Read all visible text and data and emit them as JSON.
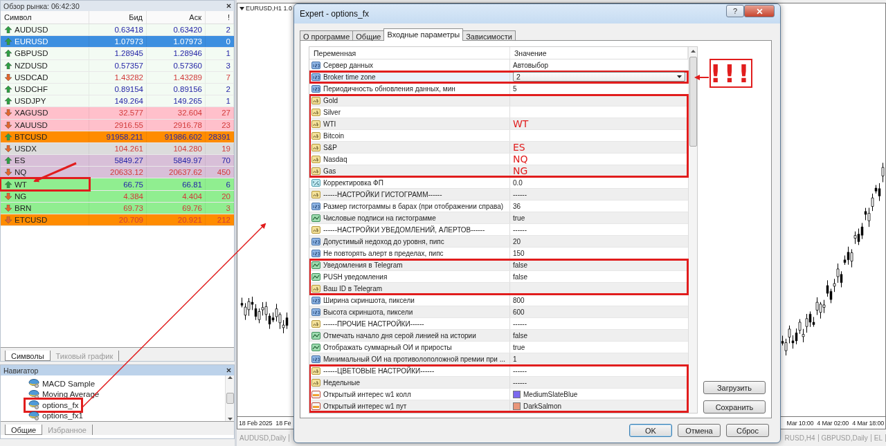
{
  "market_watch": {
    "title": "Обзор рынка: 06:42:30",
    "columns": [
      "Символ",
      "Бид",
      "Аск",
      "!"
    ],
    "rows": [
      {
        "symbol": "AUDUSD",
        "bid": "0.63418",
        "ask": "0.63420",
        "spread": "2",
        "up": true,
        "color": "#f3fbf3",
        "selected": false,
        "outlined": false
      },
      {
        "symbol": "EURUSD",
        "bid": "1.07973",
        "ask": "1.07973",
        "spread": "0",
        "up": true,
        "selected": true,
        "outlined": false
      },
      {
        "symbol": "GBPUSD",
        "bid": "1.28945",
        "ask": "1.28946",
        "spread": "1",
        "up": true,
        "color": "#f3fbf3",
        "selected": false,
        "outlined": false
      },
      {
        "symbol": "NZDUSD",
        "bid": "0.57357",
        "ask": "0.57360",
        "spread": "3",
        "up": true,
        "color": "#f3fbf3",
        "selected": false,
        "outlined": false
      },
      {
        "symbol": "USDCAD",
        "bid": "1.43282",
        "ask": "1.43289",
        "spread": "7",
        "up": false,
        "color": "#f3fbf3",
        "selected": false,
        "outlined": false
      },
      {
        "symbol": "USDCHF",
        "bid": "0.89154",
        "ask": "0.89156",
        "spread": "2",
        "up": true,
        "color": "#f3fbf3",
        "selected": false,
        "outlined": false
      },
      {
        "symbol": "USDJPY",
        "bid": "149.264",
        "ask": "149.265",
        "spread": "1",
        "up": true,
        "color": "#f3fbf3",
        "selected": false,
        "outlined": false
      },
      {
        "symbol": "XAGUSD",
        "bid": "32.577",
        "ask": "32.604",
        "spread": "27",
        "up": false,
        "color": "#ffc0cb",
        "selected": false,
        "outlined": false
      },
      {
        "symbol": "XAUUSD",
        "bid": "2916.55",
        "ask": "2916.78",
        "spread": "23",
        "up": false,
        "color": "#ffc0cb",
        "selected": false,
        "outlined": false
      },
      {
        "symbol": "BTCUSD",
        "bid": "91958.211",
        "ask": "91986.602",
        "spread": "28391",
        "up": true,
        "color": "#ff8c00",
        "selected": false,
        "outlined": false
      },
      {
        "symbol": "USDX",
        "bid": "104.261",
        "ask": "104.280",
        "spread": "19",
        "up": false,
        "color": "#dcdcdc",
        "selected": false,
        "outlined": false
      },
      {
        "symbol": "ES",
        "bid": "5849.27",
        "ask": "5849.97",
        "spread": "70",
        "up": true,
        "color": "#d8bfd8",
        "selected": false,
        "outlined": false
      },
      {
        "symbol": "NQ",
        "bid": "20633.12",
        "ask": "20637.62",
        "spread": "450",
        "up": false,
        "color": "#d8bfd8",
        "selected": false,
        "outlined": false
      },
      {
        "symbol": "WT",
        "bid": "66.75",
        "ask": "66.81",
        "spread": "6",
        "up": true,
        "color": "#90ee90",
        "selected": false,
        "outlined": true
      },
      {
        "symbol": "NG",
        "bid": "4.384",
        "ask": "4.404",
        "spread": "20",
        "up": false,
        "color": "#90ee90",
        "selected": false,
        "outlined": false
      },
      {
        "symbol": "BRN",
        "bid": "69.73",
        "ask": "69.76",
        "spread": "3",
        "up": false,
        "color": "#90ee90",
        "selected": false,
        "outlined": false
      },
      {
        "symbol": "ETCUSD",
        "bid": "20.709",
        "ask": "20.921",
        "spread": "212",
        "up": false,
        "color": "#ff8c00",
        "selected": false,
        "outlined": false
      }
    ],
    "tabs": [
      {
        "label": "Символы",
        "selected": true
      },
      {
        "label": "Тиковый график",
        "selected": false
      }
    ]
  },
  "navigator": {
    "title": "Навигатор",
    "items": [
      {
        "label": "MACD Sample",
        "outlined": false
      },
      {
        "label": "Moving Average",
        "outlined": false
      },
      {
        "label": "options_fx",
        "outlined": true
      },
      {
        "label": "options_fx1",
        "outlined": false
      }
    ],
    "tabs": [
      {
        "label": "Общие",
        "selected": true
      },
      {
        "label": "Избранное",
        "selected": false
      }
    ]
  },
  "chart": {
    "title": "EURUSD,H1 1.0",
    "dates_left": [
      "18 Feb 2025",
      "18 Fe"
    ],
    "dates_right": [
      "Mar 10:00",
      "4 Mar 02:00",
      "4 Mar 18:00"
    ],
    "tabs_left": [
      "AUDUSD,Daily"
    ],
    "tabs_right": [
      "RUSD,H4",
      "GBPUSD,Daily",
      "EL"
    ]
  },
  "dialog": {
    "title": "Expert - options_fx",
    "help_button": "?",
    "tabs": [
      {
        "label": "О программе",
        "selected": false
      },
      {
        "label": "Общие",
        "selected": false
      },
      {
        "label": "Входные параметры",
        "selected": true
      },
      {
        "label": "Зависимости",
        "selected": false
      }
    ],
    "columns": [
      "Переменная",
      "Значение"
    ],
    "groups": [
      {
        "outlined": false,
        "rows": [
          {
            "kind": "int",
            "name": "Сервер данных",
            "value": "Автовыбор",
            "selected": false
          }
        ]
      },
      {
        "outlined": true,
        "rows": [
          {
            "kind": "int",
            "name": "Broker time zone",
            "value": "2",
            "selected": true,
            "dropdown": true
          }
        ]
      },
      {
        "outlined": false,
        "rows": [
          {
            "kind": "int",
            "name": "Периодичность обновления данных, мин",
            "value": "5",
            "selected": false
          }
        ]
      },
      {
        "outlined": true,
        "rows": [
          {
            "kind": "string",
            "name": "Gold",
            "selected": false
          },
          {
            "kind": "string",
            "name": "Silver",
            "selected": false
          },
          {
            "kind": "string",
            "name": "WTI",
            "note": "WT",
            "selected": false
          },
          {
            "kind": "string",
            "name": "Bitcoin",
            "selected": false
          },
          {
            "kind": "string",
            "name": "S&P",
            "note": "ES",
            "selected": false
          },
          {
            "kind": "string",
            "name": "Nasdaq",
            "note": "NQ",
            "selected": false
          },
          {
            "kind": "string",
            "name": "Gas",
            "note": "NG",
            "selected": false
          }
        ]
      },
      {
        "outlined": false,
        "rows": [
          {
            "kind": "double",
            "name": "Корректировка ФП",
            "value": "0.0",
            "selected": false
          },
          {
            "kind": "string",
            "name": "------НАСТРОЙКИ ГИСТОГРАММ------",
            "value": "------",
            "selected": false
          },
          {
            "kind": "int",
            "name": "Размер гистограммы в барах (при отображении справа)",
            "value": "36",
            "selected": false
          },
          {
            "kind": "bool",
            "name": "Числовые подписи на гистограмме",
            "value": "true",
            "selected": false
          },
          {
            "kind": "string",
            "name": "------НАСТРОЙКИ УВЕДОМЛЕНИЙ, АЛЕРТОВ------",
            "value": "------",
            "selected": false
          },
          {
            "kind": "int",
            "name": "Допустимый недоход до уровня, пипс",
            "value": "20",
            "selected": false
          },
          {
            "kind": "int",
            "name": "Не повторять алерт в пределах, пипс",
            "value": "150",
            "selected": false
          }
        ]
      },
      {
        "outlined": true,
        "rows": [
          {
            "kind": "bool",
            "name": "Уведомления в Telegram",
            "value": "false",
            "selected": false
          },
          {
            "kind": "bool",
            "name": "PUSH уведомления",
            "value": "false",
            "selected": false
          },
          {
            "kind": "string",
            "name": "Ваш ID в Telegram",
            "selected": false
          }
        ]
      },
      {
        "outlined": false,
        "rows": [
          {
            "kind": "int",
            "name": "Ширина скриншота, пиксели",
            "value": "800",
            "selected": false
          },
          {
            "kind": "int",
            "name": "Высота скриншота, пиксели",
            "value": "600",
            "selected": false
          },
          {
            "kind": "string",
            "name": "------ПРОЧИЕ НАСТРОЙКИ------",
            "value": "------",
            "selected": false
          },
          {
            "kind": "bool",
            "name": "Отмечать начало дня серой линией на истории",
            "value": "false",
            "selected": false
          },
          {
            "kind": "bool",
            "name": "Отображать суммарный ОИ и приросты",
            "value": "true",
            "selected": false
          },
          {
            "kind": "int",
            "name": "Минимальный ОИ на противолоположной премии при ...",
            "value": "1",
            "selected": false
          }
        ]
      },
      {
        "outlined": true,
        "rows": [
          {
            "kind": "string",
            "name": "------ЦВЕТОВЫЕ НАСТРОЙКИ------",
            "value": "------",
            "selected": false
          },
          {
            "kind": "string",
            "name": "Недельные",
            "value": "------",
            "selected": false
          },
          {
            "kind": "color",
            "name": "Открытый интерес w1 колл",
            "value": "MediumSlateBlue",
            "color": "#7b68ee",
            "selected": false
          },
          {
            "kind": "color",
            "name": "Открытый интерес w1 пут",
            "value": "DarkSalmon",
            "color": "#e9967a",
            "selected": false
          }
        ]
      }
    ],
    "side_buttons": [
      "Загрузить",
      "Сохранить"
    ],
    "buttons": [
      {
        "label": "OK",
        "default": true
      },
      {
        "label": "Отмена",
        "default": false
      },
      {
        "label": "Сброс",
        "default": false
      }
    ]
  },
  "callout": "!!!"
}
